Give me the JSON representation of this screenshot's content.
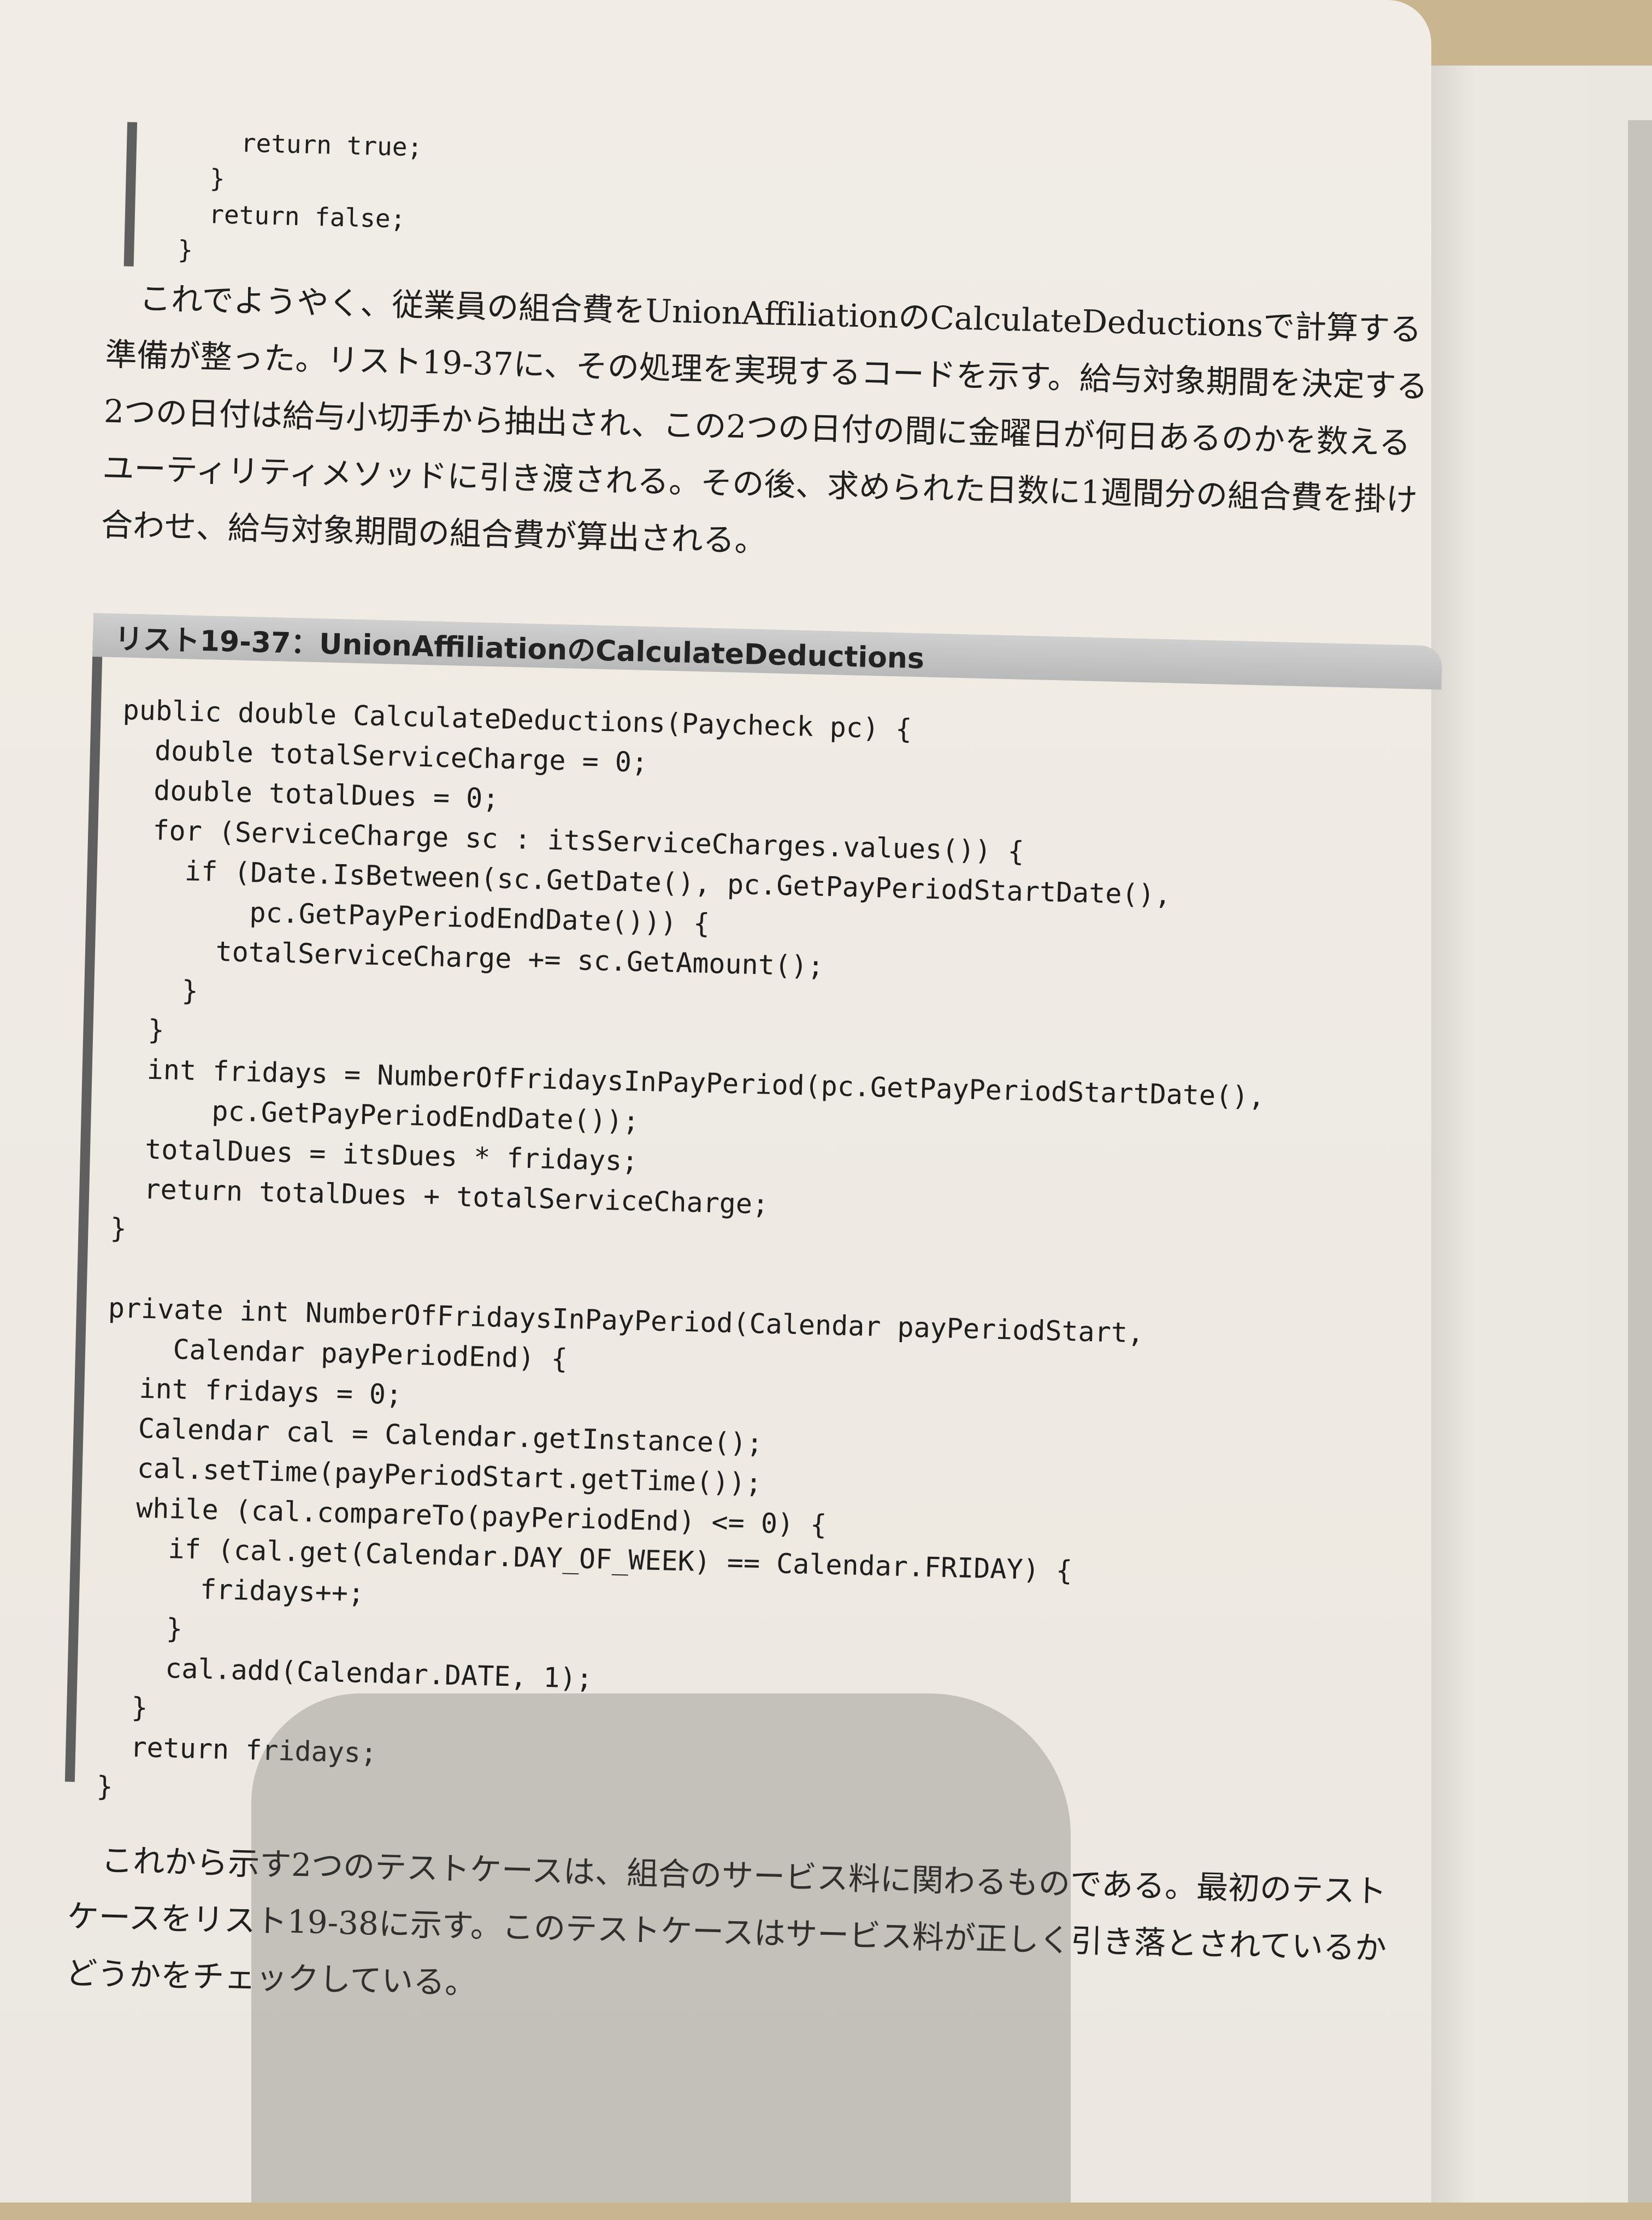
{
  "code_top": "    return true;\n  }\n  return false;\n}",
  "paragraph_1": "これでようやく、従業員の組合費をUnionAffiliationのCalculateDeductionsで計算する準備が整った。リスト19-37に、その処理を実現するコードを示す。給与対象期間を決定する2つの日付は給与小切手から抽出され、この2つの日付の間に金曜日が何日あるのかを数えるユーティリティメソッドに引き渡される。その後、求められた日数に1週間分の組合費を掛け合わせ、給与対象期間の組合費が算出される。",
  "listing": {
    "title": "リスト19-37：UnionAffiliationのCalculateDeductions",
    "code": "public double CalculateDeductions(Paycheck pc) {\n  double totalServiceCharge = 0;\n  double totalDues = 0;\n  for (ServiceCharge sc : itsServiceCharges.values()) {\n    if (Date.IsBetween(sc.GetDate(), pc.GetPayPeriodStartDate(),\n        pc.GetPayPeriodEndDate())) {\n      totalServiceCharge += sc.GetAmount();\n    }\n  }\n  int fridays = NumberOfFridaysInPayPeriod(pc.GetPayPeriodStartDate(),\n      pc.GetPayPeriodEndDate());\n  totalDues = itsDues * fridays;\n  return totalDues + totalServiceCharge;\n}\n\nprivate int NumberOfFridaysInPayPeriod(Calendar payPeriodStart,\n    Calendar payPeriodEnd) {\n  int fridays = 0;\n  Calendar cal = Calendar.getInstance();\n  cal.setTime(payPeriodStart.getTime());\n  while (cal.compareTo(payPeriodEnd) <= 0) {\n    if (cal.get(Calendar.DAY_OF_WEEK) == Calendar.FRIDAY) {\n      fridays++;\n    }\n    cal.add(Calendar.DATE, 1);\n  }\n  return fridays;\n}"
  },
  "paragraph_2": "これから示す2つのテストケースは、組合のサービス料に関わるものである。最初のテストケースをリスト19-38に示す。このテストケースはサービス料が正しく引き落とされているかどうかをチェックしている。"
}
